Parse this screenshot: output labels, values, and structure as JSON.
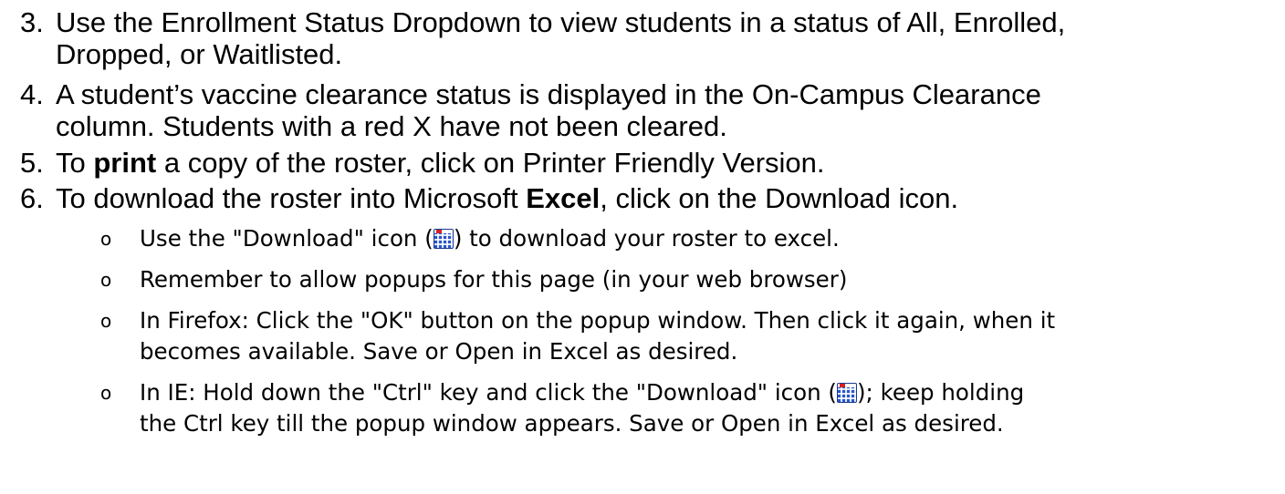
{
  "items": [
    {
      "number": "3.",
      "lines": [
        "Use the Enrollment Status Dropdown to view students in a status of All, Enrolled,",
        "Dropped, or Waitlisted."
      ]
    },
    {
      "number": "4.",
      "lines": [
        "A student’s vaccine clearance status is displayed in the On-Campus Clearance",
        "column.  Students with a red X have not been cleared."
      ]
    },
    {
      "number": "5.",
      "pre": "To ",
      "bold": "print",
      "post": " a copy of the roster, click on Printer Friendly Version."
    },
    {
      "number": "6.",
      "pre": "To download the roster into Microsoft ",
      "bold": "Excel",
      "post": ", click on the Download icon."
    }
  ],
  "subitems": [
    {
      "bullet": "o",
      "pre": "Use the \"Download\" icon (",
      "icon": "download-excel-icon",
      "post": ") to download your roster to excel."
    },
    {
      "bullet": "o",
      "line1": "Remember to allow popups for this page (in your web browser)"
    },
    {
      "bullet": "o",
      "line1": "In Firefox: Click the \"OK\" button on the popup window. Then click it again, when it",
      "line2": "becomes available.  Save or Open in Excel as desired."
    },
    {
      "bullet": "o",
      "pre": "In IE: Hold down the \"Ctrl\" key and click the \"Download\" icon (",
      "icon": "download-excel-icon",
      "post": "); keep holding",
      "line2": "the Ctrl key till the popup window appears. Save or Open in Excel as desired."
    }
  ]
}
